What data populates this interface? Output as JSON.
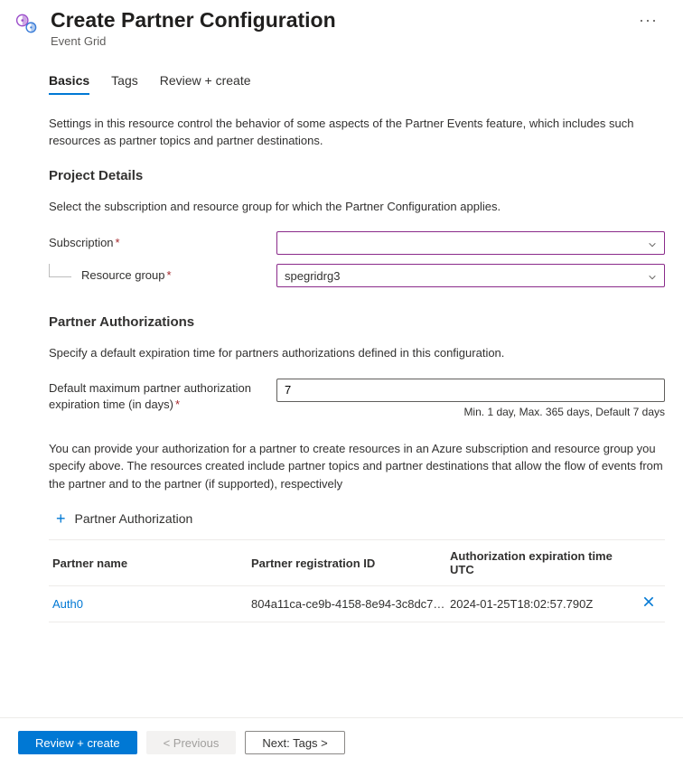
{
  "header": {
    "title": "Create Partner Configuration",
    "subtitle": "Event Grid"
  },
  "tabs": {
    "basics": "Basics",
    "tags": "Tags",
    "review": "Review + create"
  },
  "intro": "Settings in this resource control the behavior of some aspects of the Partner Events feature, which includes such resources as partner topics and partner destinations.",
  "project": {
    "heading": "Project Details",
    "desc": "Select the subscription and resource group for which the Partner Configuration applies.",
    "subscription_label": "Subscription",
    "subscription_value": "",
    "resource_group_label": "Resource group",
    "resource_group_value": "spegridrg3"
  },
  "auth": {
    "heading": "Partner Authorizations",
    "desc": "Specify a default expiration time for partners authorizations defined in this configuration.",
    "expiry_label": "Default maximum partner authorization expiration time (in days)",
    "expiry_value": "7",
    "expiry_hint": "Min. 1 day, Max. 365 days, Default 7 days",
    "paragraph": "You can provide your authorization for a partner to create resources in an Azure subscription and resource group you specify above. The resources created include partner topics and partner destinations that allow the flow of events from the partner and to the partner (if supported), respectively",
    "add_label": "Partner Authorization",
    "columns": {
      "name": "Partner name",
      "regid": "Partner registration ID",
      "exp": "Authorization expiration time UTC"
    },
    "rows": [
      {
        "name": "Auth0",
        "regid": "804a11ca-ce9b-4158-8e94-3c8dc7…",
        "exp": "2024-01-25T18:02:57.790Z"
      }
    ]
  },
  "footer": {
    "review": "Review + create",
    "prev": "< Previous",
    "next": "Next: Tags >"
  }
}
